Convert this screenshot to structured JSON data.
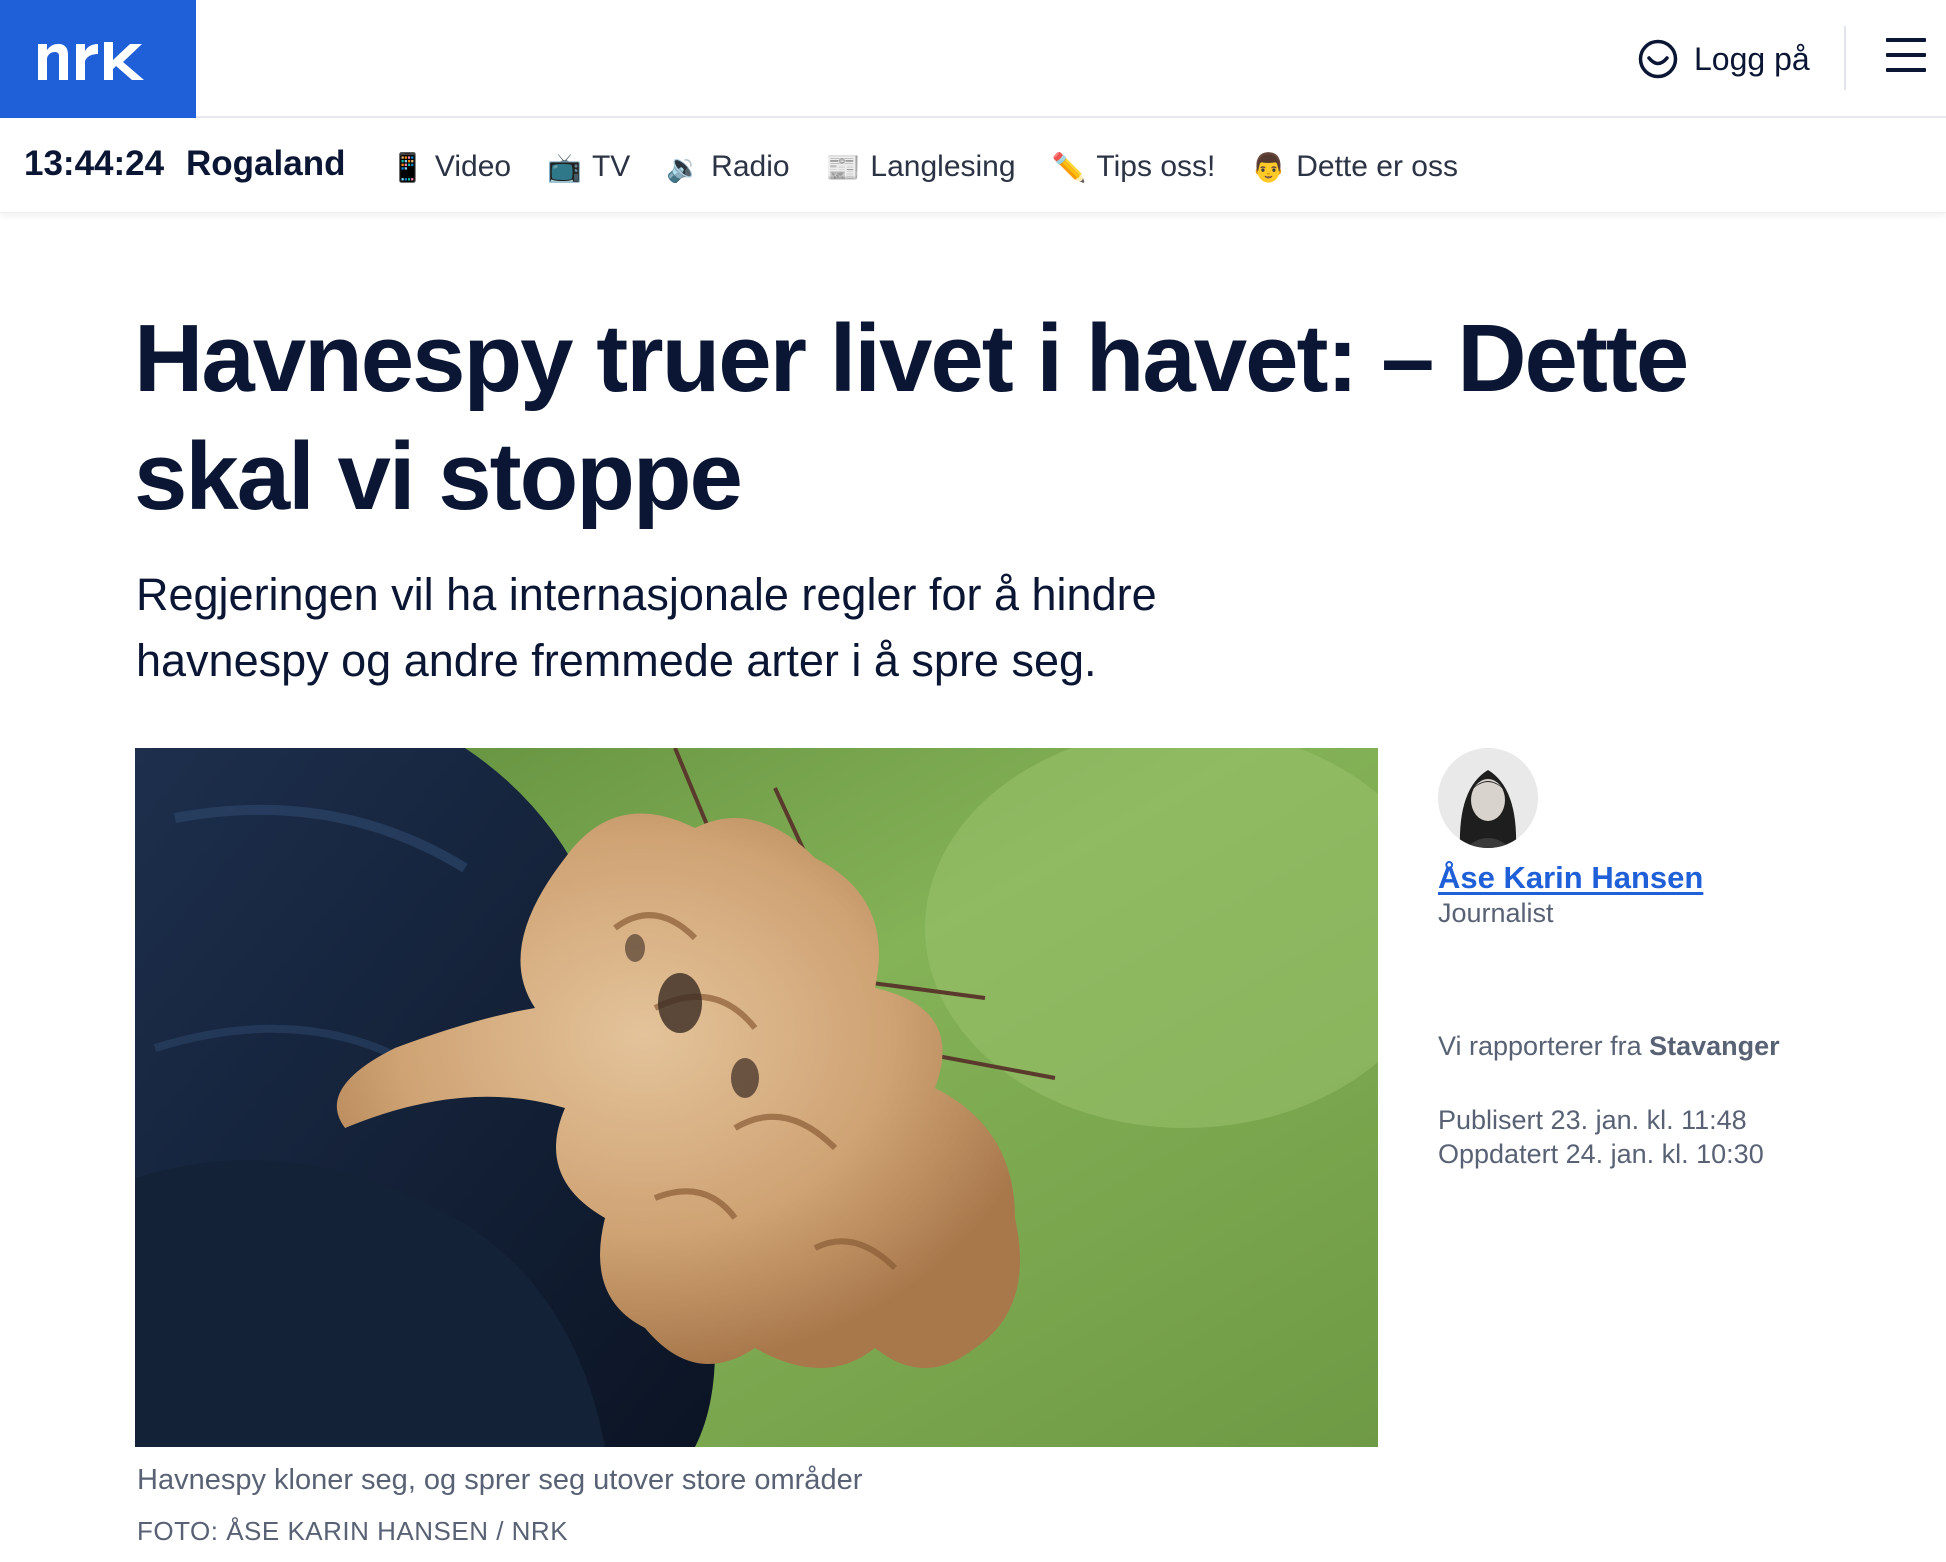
{
  "header": {
    "logo_text": "NRK",
    "login_label": "Logg på"
  },
  "subnav": {
    "clock": "13:44:24",
    "region": "Rogaland",
    "links": [
      {
        "icon": "mobile-phone-icon",
        "emoji": "📱",
        "label": "Video"
      },
      {
        "icon": "television-icon",
        "emoji": "📺",
        "label": "TV"
      },
      {
        "icon": "speaker-icon",
        "emoji": "🔉",
        "label": "Radio"
      },
      {
        "icon": "newspaper-icon",
        "emoji": "📰",
        "label": "Langlesing"
      },
      {
        "icon": "pencil-icon",
        "emoji": "✏️",
        "label": "Tips oss!"
      },
      {
        "icon": "person-icon",
        "emoji": "👨",
        "label": "Dette er oss"
      }
    ]
  },
  "article": {
    "headline": "Havnespy truer livet i havet: – Dette skal vi stoppe",
    "lead": "Regjeringen vil ha internasjonale regler for å hindre havnespy og andre fremmede arter i å spre seg.",
    "image_caption": "Havnespy kloner seg, og sprer seg utover store områder",
    "image_credit": "FOTO: ÅSE KARIN HANSEN / NRK"
  },
  "byline": {
    "author": "Åse Karin Hansen",
    "role": "Journalist",
    "reporting_prefix": "Vi rapporterer fra",
    "reporting_place": "Stavanger",
    "published": "Publisert 23. jan. kl. 11:48",
    "updated": "Oppdatert 24. jan. kl. 10:30"
  },
  "colors": {
    "brand_blue": "#1f5fd8",
    "text_dark": "#0a1633",
    "text_muted": "#596275"
  }
}
